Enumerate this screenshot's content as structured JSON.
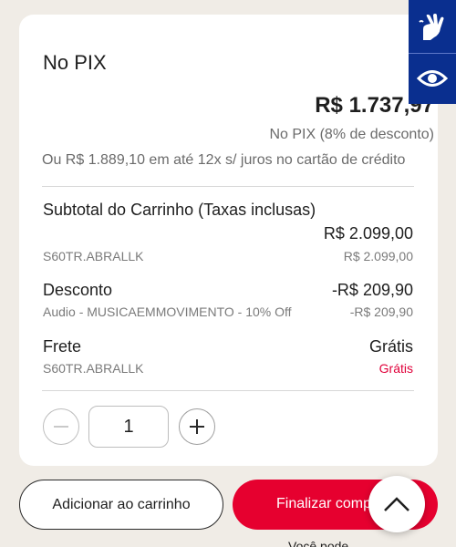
{
  "summary": {
    "title": "No PIX",
    "price": "R$ 1.737,97",
    "pix_note": "No PIX (8% de desconto)",
    "installments": "Ou R$ 1.889,10 em até 12x s/ juros no cartão de crédito"
  },
  "rows": {
    "subtotal": {
      "label": "Subtotal do Carrinho (Taxas inclusas)",
      "value": "R$ 2.099,00",
      "sub_label": "S60TR.ABRALLK",
      "sub_value": "R$ 2.099,00"
    },
    "discount": {
      "label": "Desconto",
      "value": "-R$ 209,90",
      "sub_label": "Audio - MUSICAEMMOVIMENTO - 10% Off",
      "sub_value": "-R$ 209,90"
    },
    "shipping": {
      "label": "Frete",
      "value": "Grátis",
      "sub_label": "S60TR.ABRALLK",
      "sub_value": "Grátis"
    }
  },
  "quantity": {
    "value": "1",
    "minus_icon": "minus-icon",
    "plus_icon": "plus-icon"
  },
  "actions": {
    "add_to_cart": "Adicionar ao carrinho",
    "checkout": "Finalizar compra",
    "scroll_top_icon": "chevron-up-icon",
    "peek_text": "Você pode"
  },
  "accessibility": {
    "sign_language_icon": "sign-language-icon",
    "eye_icon": "eye-icon"
  },
  "colors": {
    "accent": "#e6002f",
    "a11y_panel": "#0a2f8f",
    "background": "#f0ece6"
  }
}
